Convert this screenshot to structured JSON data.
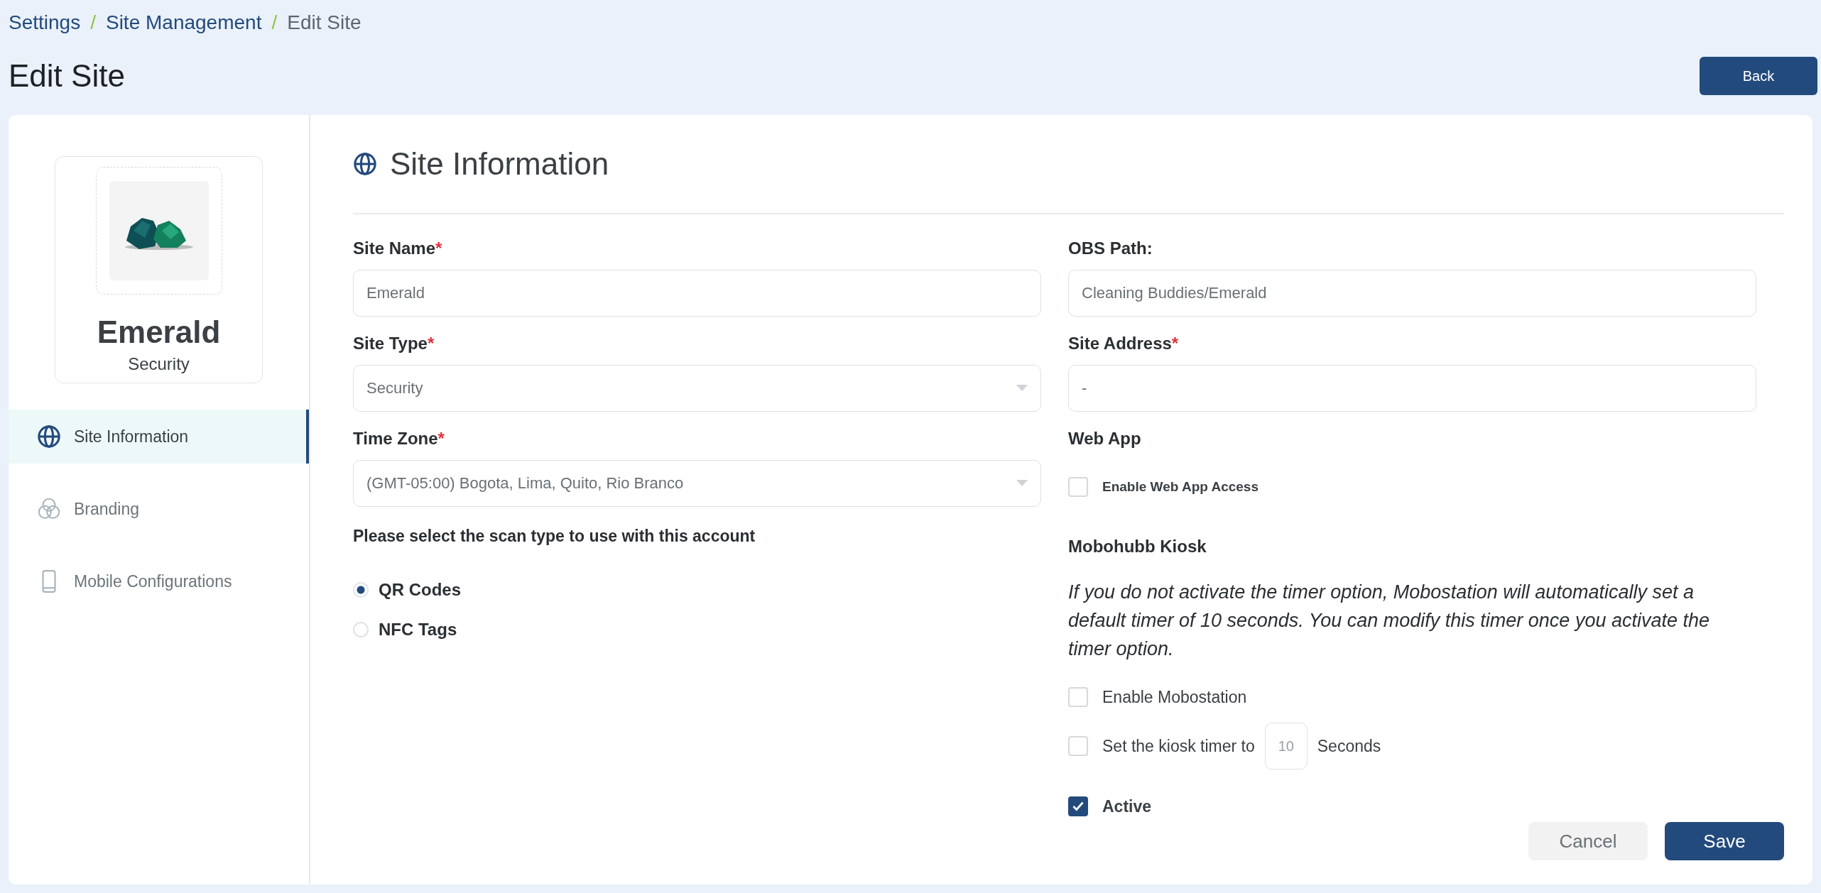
{
  "breadcrumbs": [
    {
      "label": "Settings",
      "current": false
    },
    {
      "label": "Site Management",
      "current": false
    },
    {
      "label": "Edit Site",
      "current": true
    }
  ],
  "breadcrumb_separator": "/",
  "title": "Edit Site",
  "back_button": "Back",
  "profile": {
    "name": "Emerald",
    "type": "Security"
  },
  "nav": [
    {
      "label": "Site Information",
      "selected": true
    },
    {
      "label": "Branding",
      "selected": false
    },
    {
      "label": "Mobile Configurations",
      "selected": false
    }
  ],
  "section_title": "Site Information",
  "left_fields": [
    {
      "kind": "text",
      "label": "Site Name",
      "required_mark": "*",
      "value": "Emerald"
    },
    {
      "kind": "select",
      "label": "Site Type",
      "required_mark": "*",
      "value": "Security"
    },
    {
      "kind": "select",
      "label": "Time Zone",
      "required_mark": "*",
      "value": "(GMT-05:00) Bogota, Lima, Quito, Rio Branco"
    }
  ],
  "scan_prompt": "Please select the scan type to use with this account",
  "scan_options": [
    {
      "label": "QR Codes",
      "selected": true
    },
    {
      "label": "NFC Tags",
      "selected": false
    }
  ],
  "right_fields": [
    {
      "label": "OBS Path:",
      "value": "Cleaning Buddies/Emerald"
    },
    {
      "label": "Site Address",
      "required_mark": "*",
      "value": "-"
    }
  ],
  "web_app": {
    "heading": "Web App",
    "option": {
      "label": "Enable Web App Access",
      "checked": false
    }
  },
  "kiosk": {
    "heading": "Mobohubb Kiosk",
    "note": "If you do not activate the timer option, Mobostation will automatically set a default timer of 10 seconds. You can modify this timer once you activate the timer option.",
    "options": [
      {
        "kind": "checkbox",
        "label": "Enable Mobostation",
        "checked": false
      },
      {
        "kind": "timer",
        "label": "Set the kiosk timer to",
        "value": "10",
        "unit": "Seconds",
        "checked": false
      }
    ]
  },
  "active": {
    "label": "Active",
    "checked": true
  },
  "buttons": {
    "cancel": "Cancel",
    "save": "Save"
  }
}
